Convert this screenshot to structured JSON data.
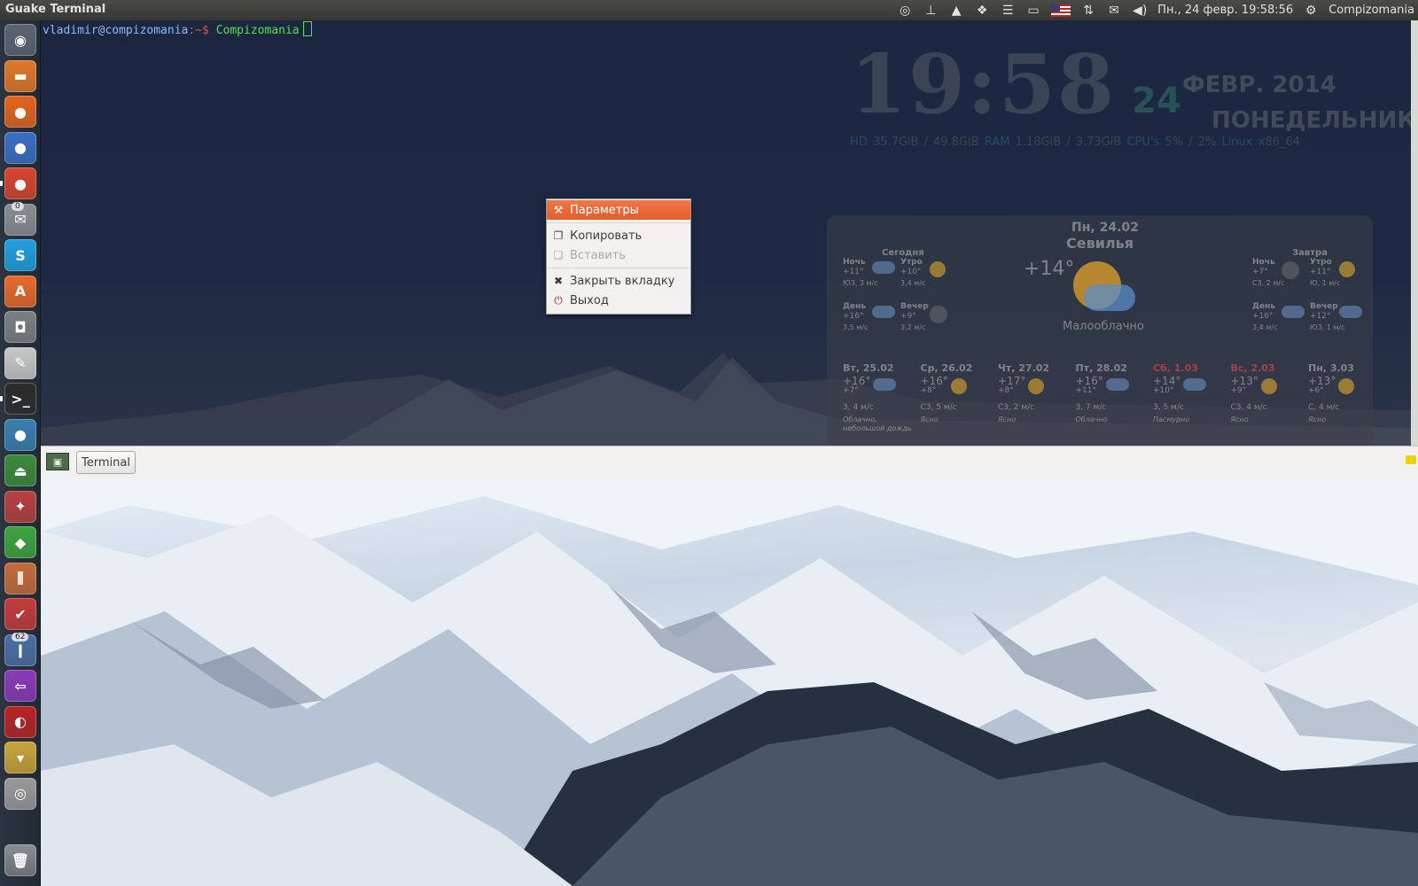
{
  "top_panel": {
    "app_title": "Guake Terminal",
    "datetime": "Пн., 24 февр. 19:58:56",
    "user": "Compizomania",
    "tray_icons": [
      "lightbulb-icon",
      "thermometer-icon",
      "cloud-drive-icon",
      "dropbox-icon",
      "menu-list-icon",
      "battery-icon",
      "keyboard-flag-icon",
      "network-arrows-icon",
      "mail-icon",
      "volume-icon",
      "gear-icon"
    ]
  },
  "launcher": {
    "items": [
      {
        "name": "dash-home",
        "glyph": "◉",
        "color": "#5b6571"
      },
      {
        "name": "files",
        "glyph": "▬",
        "color": "#e1782b"
      },
      {
        "name": "firefox",
        "glyph": "●",
        "color": "#e4641c"
      },
      {
        "name": "browser-globe",
        "glyph": "●",
        "color": "#3a6fc3"
      },
      {
        "name": "chrome",
        "glyph": "●",
        "color": "#d9442f",
        "pip": true
      },
      {
        "name": "notifications",
        "glyph": "✉",
        "color": "#8a8d92",
        "badge": "0"
      },
      {
        "name": "skype",
        "glyph": "S",
        "color": "#1fa0e0"
      },
      {
        "name": "software-center",
        "glyph": "A",
        "color": "#e8692a"
      },
      {
        "name": "camera",
        "glyph": "◘",
        "color": "#7c7f84"
      },
      {
        "name": "text-editor",
        "glyph": "✎",
        "color": "#c8c8c8"
      },
      {
        "name": "terminal",
        "glyph": ">_",
        "color": "#2c2c2c",
        "pip": true
      },
      {
        "name": "thunderbird",
        "glyph": "●",
        "color": "#3a7fb0"
      },
      {
        "name": "eject-tool",
        "glyph": "⏏",
        "color": "#3c8a3c"
      },
      {
        "name": "tweak-tool",
        "glyph": "✦",
        "color": "#b84040"
      },
      {
        "name": "hardware-chip",
        "glyph": "◆",
        "color": "#3da53d"
      },
      {
        "name": "mixer",
        "glyph": "⫼",
        "color": "#c46c3c"
      },
      {
        "name": "search-check",
        "glyph": "✔",
        "color": "#c63a3a"
      },
      {
        "name": "thermometer",
        "glyph": "ǀ",
        "color": "#4a6fa5",
        "badge": "62"
      },
      {
        "name": "exit-arrow",
        "glyph": "⇦",
        "color": "#8a3ab8"
      },
      {
        "name": "speedometer",
        "glyph": "◐",
        "color": "#b82424"
      },
      {
        "name": "folder-download",
        "glyph": "▾",
        "color": "#c9a43a"
      },
      {
        "name": "disk-usage",
        "glyph": "◎",
        "color": "#9a9a9a"
      }
    ],
    "trash": "trash-icon"
  },
  "terminal": {
    "prompt_user": "vladimir@compizomania",
    "prompt_path": ":~$",
    "command": "Compizomania"
  },
  "conky": {
    "time": "19:58",
    "day": "24",
    "month_year": "ФЕВР. 2014",
    "weekday": "ПОНЕДЕЛЬНИК",
    "hd_label": "HD",
    "hd_value": "35.7GiB / 49.8GiB",
    "ram_label": "RAM",
    "ram_value": "1.18GiB / 3.73GiB",
    "cpu_label": "CPU's",
    "cpu_value": "5% / 2%",
    "os_label": "Linux",
    "os_value": "x86_64"
  },
  "weather": {
    "date": "Пн, 24.02",
    "city": "Севилья",
    "current_temp": "+14°",
    "condition": "Малооблачно",
    "today": {
      "label": "Сегодня",
      "parts": [
        {
          "name": "Ночь",
          "temp": "+11°",
          "wind": "ЮЗ, 3 м/с",
          "icon": "cloud"
        },
        {
          "name": "Утро",
          "temp": "+10°",
          "wind": "3,4 м/с",
          "icon": "sun"
        },
        {
          "name": "День",
          "temp": "+16°",
          "wind": "3,5 м/с",
          "icon": "cloud"
        },
        {
          "name": "Вечер",
          "temp": "+9°",
          "wind": "3,2 м/с",
          "icon": "moon"
        }
      ]
    },
    "tomorrow": {
      "label": "Завтра",
      "parts": [
        {
          "name": "Ночь",
          "temp": "+7°",
          "wind": "С3, 2 м/с",
          "icon": "moon"
        },
        {
          "name": "Утро",
          "temp": "+11°",
          "wind": "Ю, 1 м/с",
          "icon": "sun"
        },
        {
          "name": "День",
          "temp": "+16°",
          "wind": "3,4 м/с",
          "icon": "cloud"
        },
        {
          "name": "Вечер",
          "temp": "+12°",
          "wind": "ЮЗ, 1 м/с",
          "icon": "cloud"
        }
      ]
    },
    "forecast": [
      {
        "day": "Вт, 25.02",
        "hi": "+16°",
        "lo": "+7°",
        "wind": "3, 4 м/с",
        "desc": "Облачно, небольшой дождь",
        "icon": "cloud",
        "weekend": false
      },
      {
        "day": "Ср, 26.02",
        "hi": "+16°",
        "lo": "+8°",
        "wind": "С3, 5 м/с",
        "desc": "Ясно",
        "icon": "sun",
        "weekend": false
      },
      {
        "day": "Чт, 27.02",
        "hi": "+17°",
        "lo": "+8°",
        "wind": "С3, 2 м/с",
        "desc": "Ясно",
        "icon": "sun",
        "weekend": false
      },
      {
        "day": "Пт, 28.02",
        "hi": "+16°",
        "lo": "+11°",
        "wind": "3, 7 м/с",
        "desc": "Облачно",
        "icon": "cloud",
        "weekend": false
      },
      {
        "day": "Сб, 1.03",
        "hi": "+14°",
        "lo": "+10°",
        "wind": "3, 5 м/с",
        "desc": "Пасмурно",
        "icon": "cloud",
        "weekend": true
      },
      {
        "day": "Вс, 2.03",
        "hi": "+13°",
        "lo": "+9°",
        "wind": "С3, 4 м/с",
        "desc": "Ясно",
        "icon": "sun",
        "weekend": true
      },
      {
        "day": "Пн, 3.03",
        "hi": "+13°",
        "lo": "+6°",
        "wind": "С, 4 м/с",
        "desc": "Ясно",
        "icon": "sun",
        "weekend": false
      }
    ]
  },
  "context_menu": {
    "items": [
      {
        "label": "Параметры",
        "icon": "tools-icon",
        "state": "active"
      },
      {
        "label": "Копировать",
        "icon": "copy-icon",
        "state": "normal"
      },
      {
        "label": "Вставить",
        "icon": "paste-icon",
        "state": "disabled"
      },
      {
        "label": "Закрыть вкладку",
        "icon": "close-x-icon",
        "state": "normal"
      },
      {
        "label": "Выход",
        "icon": "power-icon",
        "state": "normal"
      }
    ]
  },
  "tabbar": {
    "tab_label": "Terminal"
  },
  "colors": {
    "menu_active": "#e86231",
    "prompt_user": "#8fb7ff",
    "prompt_cmd": "#4ee24e",
    "weekend": "#d04040"
  }
}
